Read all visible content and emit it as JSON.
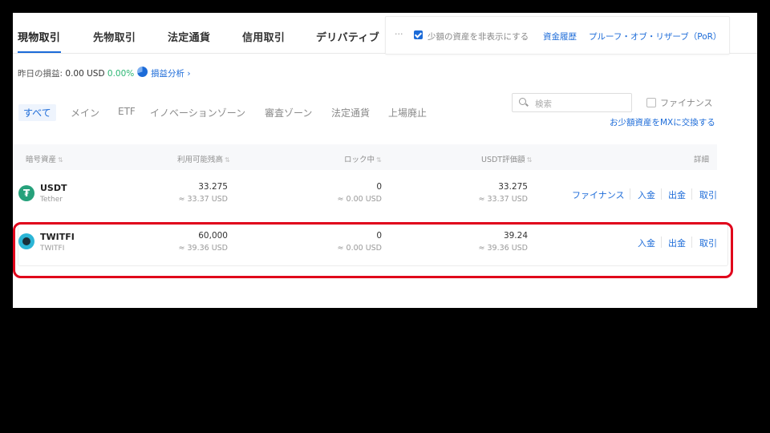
{
  "tabs": [
    "現物取引",
    "先物取引",
    "法定通貨",
    "信用取引",
    "デリバティブ"
  ],
  "overlay": {
    "more": "···",
    "hide_small_label": "少額の資産を非表示にする",
    "history_link": "資金履歴",
    "proof_link": "プルーフ・オブ・リザーブ（PoR）"
  },
  "pnl": {
    "label": "昨日の損益:",
    "usd": "0.00 USD",
    "pct": "0.00%",
    "analysis_link": "損益分析 ›"
  },
  "filters": [
    "すべて",
    "メイン",
    "ETF",
    "イノベーションゾーン",
    "審査ゾーン",
    "法定通貨",
    "上場廃止"
  ],
  "search": {
    "placeholder": "検索"
  },
  "finance_checkbox_label": "ファイナンス",
  "convert_link": "お少額資産をMXに交換する",
  "table": {
    "headers": {
      "asset": "暗号資産",
      "available": "利用可能残高",
      "locked": "ロック中",
      "usdt_value": "USDT評価額",
      "detail": "詳細"
    },
    "rows": [
      {
        "symbol": "USDT",
        "name": "Tether",
        "available": "33.275",
        "available_usd": "≈ 33.37 USD",
        "locked": "0",
        "locked_usd": "≈ 0.00 USD",
        "usdt_value": "33.275",
        "usdt_value_usd": "≈ 33.37 USD",
        "actions": [
          "ファイナンス",
          "入金",
          "出金",
          "取引"
        ]
      },
      {
        "symbol": "TWITFI",
        "name": "TWITFI",
        "available": "60,000",
        "available_usd": "≈ 39.36 USD",
        "locked": "0",
        "locked_usd": "≈ 0.00 USD",
        "usdt_value": "39.24",
        "usdt_value_usd": "≈ 39.36 USD",
        "actions": [
          "入金",
          "出金",
          "取引"
        ]
      }
    ]
  },
  "colors": {
    "accent": "#1c6bd8",
    "positive": "#2bb673",
    "highlight": "#e0001b",
    "usdt": "#26a17b"
  }
}
